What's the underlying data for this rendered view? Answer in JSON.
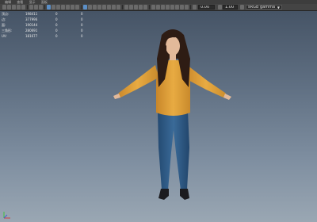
{
  "menubar": {
    "items": [
      "编辑",
      "查看",
      "显示",
      "面板"
    ]
  },
  "toolbar": {
    "field1": "0.00",
    "field2": "1.00",
    "colorspace": "sRGB gamma"
  },
  "hud": {
    "rows": [
      {
        "label": "顶点:",
        "v1": "198411",
        "v2": "0",
        "v3": "0"
      },
      {
        "label": "边:",
        "v1": "377996",
        "v2": "0",
        "v3": "0"
      },
      {
        "label": "面:",
        "v1": "190144",
        "v2": "0",
        "v3": "0"
      },
      {
        "label": "三角形:",
        "v1": "280691",
        "v2": "0",
        "v3": "0"
      },
      {
        "label": "UV:",
        "v1": "181677",
        "v2": "0",
        "v3": "0"
      }
    ]
  },
  "colors": {
    "shirt": "#e3a43a",
    "jeans": "#2c5a86",
    "hair": "#2e1c14",
    "skin": "#e2b99a"
  }
}
